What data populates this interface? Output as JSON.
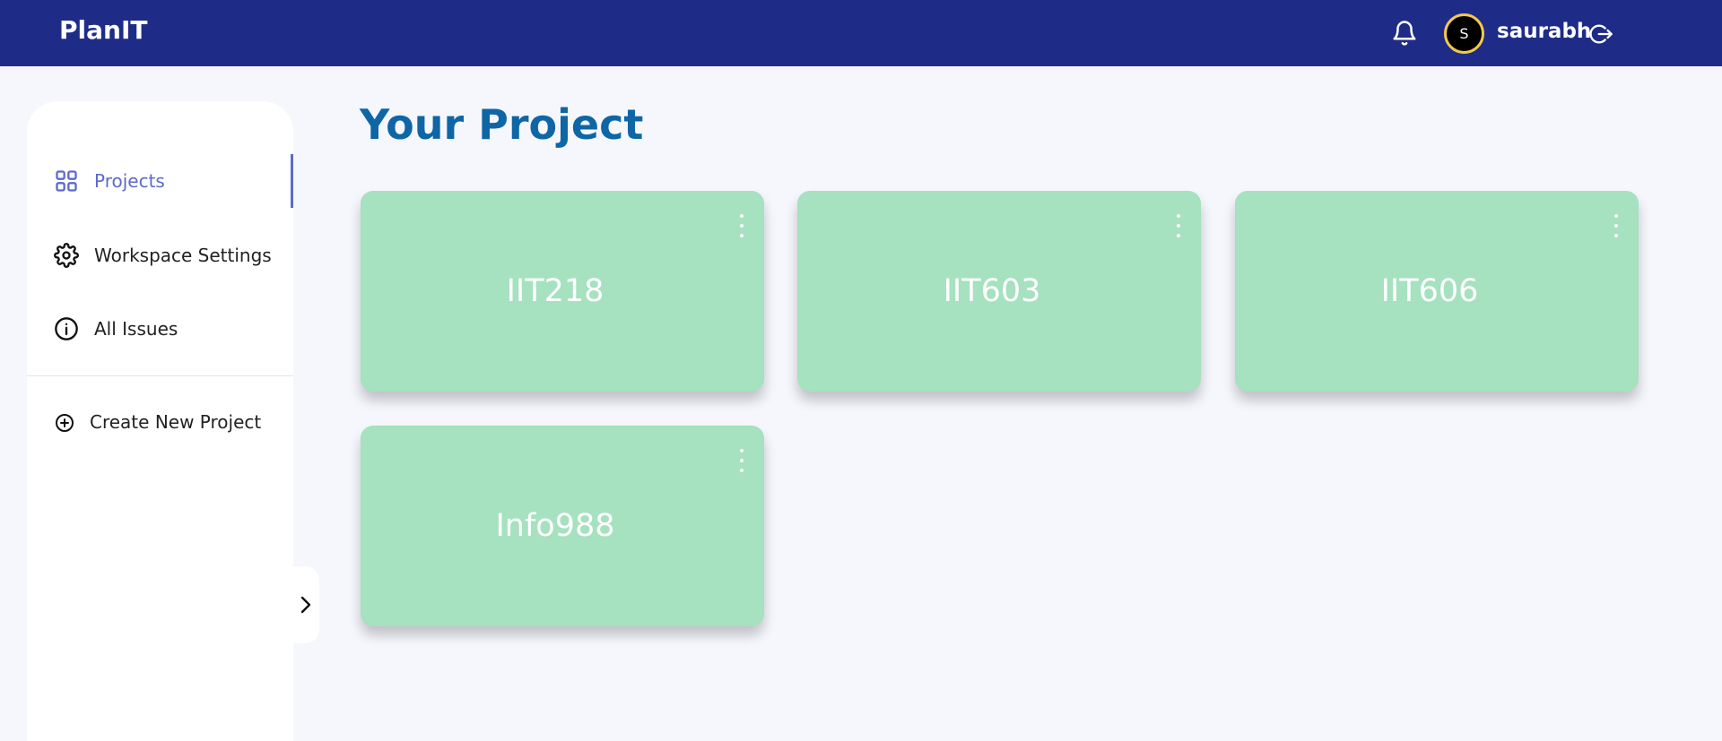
{
  "app": {
    "brand": "PlanIT"
  },
  "header": {
    "avatar_initial": "S",
    "username": "saurabh"
  },
  "sidebar": {
    "items": [
      {
        "label": "Projects",
        "icon": "grid-icon",
        "active": true
      },
      {
        "label": "Workspace Settings",
        "icon": "gear-icon",
        "active": false
      },
      {
        "label": "All Issues",
        "icon": "info-icon",
        "active": false
      }
    ],
    "create_label": "Create New Project"
  },
  "main": {
    "title": "Your Project",
    "projects": [
      {
        "name": "IIT218"
      },
      {
        "name": "IIT603"
      },
      {
        "name": "IIT606"
      },
      {
        "name": "Info988"
      }
    ]
  },
  "colors": {
    "topbar": "#1e2c88",
    "accent": "#5c6bc8",
    "title": "#0f66a6",
    "card": "#a6e1c0",
    "avatar_ring": "#f2c94c"
  }
}
